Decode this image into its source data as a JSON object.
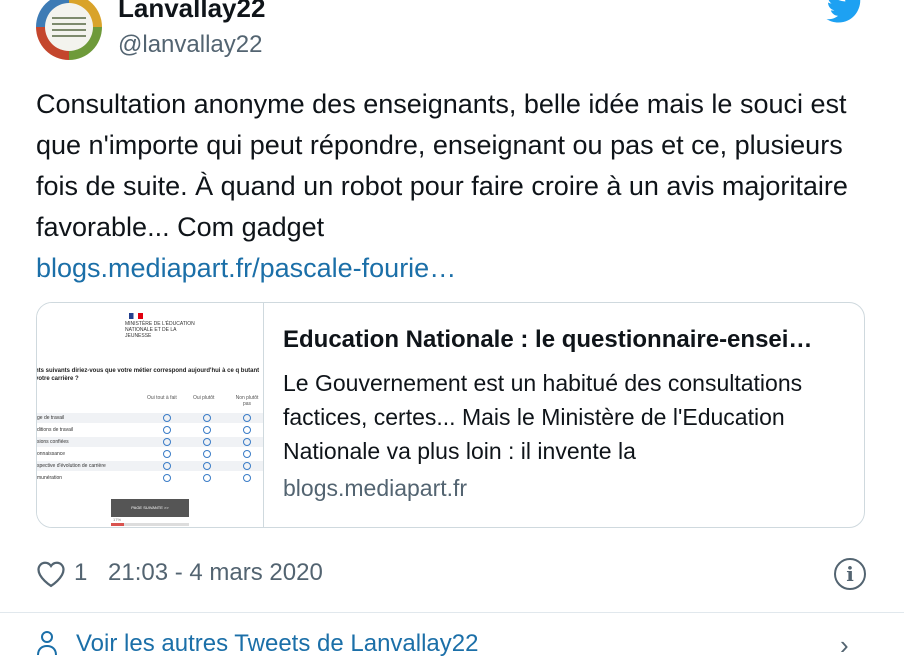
{
  "author": {
    "display_name": "Lanvallay22",
    "handle": "@lanvallay22",
    "avatar_icon": "profile-avatar"
  },
  "brand_icon": "twitter-bird-icon",
  "brand_color": "#1da1f2",
  "link_color": "#1b6fa8",
  "tweet": {
    "text": "Consultation anonyme des enseignants, belle idée mais le souci est que n'importe qui peut répondre, enseignant ou pas et ce, plusieurs fois de suite. À quand un robot pour faire croire à un avis majoritaire favorable... Com gadget",
    "link": "blogs.mediapart.fr/pascale-fourie…"
  },
  "card": {
    "title": "Education Nationale : le questionnaire-ensei…",
    "description": "Le Gouvernement est un habitué des consultations factices, certes... Mais le Ministère de l'Education Nationale va plus loin : il invente la",
    "domain": "blogs.mediapart.fr",
    "thumbnail": {
      "org": "MINISTÈRE DE L'ÉDUCATION NATIONALE ET DE LA JEUNESSE",
      "question": "nts suivants diriez-vous que votre métier correspond aujourd'hui à ce q butant votre carrière ?",
      "columns": [
        "Oui tout à fait",
        "Oui plutôt",
        "Non plutôt pas"
      ],
      "rows": [
        "ge de travail",
        "ditions de travail",
        "sions confiées",
        "onnaissance",
        "spective d'évolution de carrière",
        "munération"
      ],
      "button_label": "PAGE SUIVANTE >>",
      "progress_label": "17%",
      "progress_value": 0.17
    }
  },
  "meta": {
    "like_count": "1",
    "timestamp": "21:03 - 4 mars 2020",
    "heart_icon": "heart-icon",
    "info_icon": "info-icon"
  },
  "footer": {
    "text": "Voir les autres Tweets de Lanvallay22",
    "icon": "person-icon",
    "chevron": "›"
  }
}
